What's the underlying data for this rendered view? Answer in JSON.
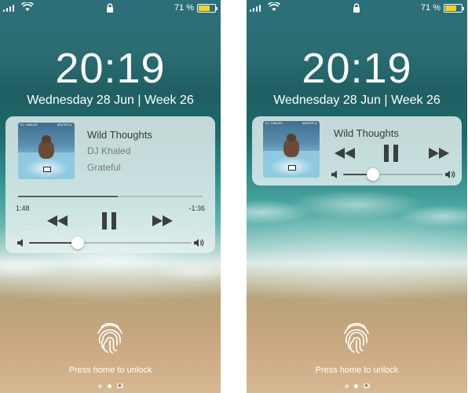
{
  "status": {
    "battery_percent": "71 %",
    "battery_level": 0.71,
    "battery_color": "#f7d21a"
  },
  "lock_screen": {
    "time": "20:19",
    "date": "Wednesday 28 Jun | Week 26",
    "unlock_hint": "Press home to unlock"
  },
  "album_art": {
    "artist_text": "DJ KHALED",
    "album_text": "GRATEFUL"
  },
  "player_expanded": {
    "track_title": "Wild Thoughts",
    "artist": "DJ Khaled",
    "album": "Grateful",
    "elapsed": "1:48",
    "remaining": "-1:36",
    "progress": 0.54,
    "volume": 0.3
  },
  "player_compact": {
    "track_title": "Wild Thoughts",
    "volume": 0.3
  },
  "page_dots": {
    "count": 2,
    "active_index": 1
  },
  "icons": [
    "signal-icon",
    "wifi-icon",
    "lock-icon",
    "battery-icon",
    "rewind-icon",
    "pause-icon",
    "fast-forward-icon",
    "volume-low-icon",
    "volume-high-icon",
    "fingerprint-icon",
    "camera-icon"
  ]
}
